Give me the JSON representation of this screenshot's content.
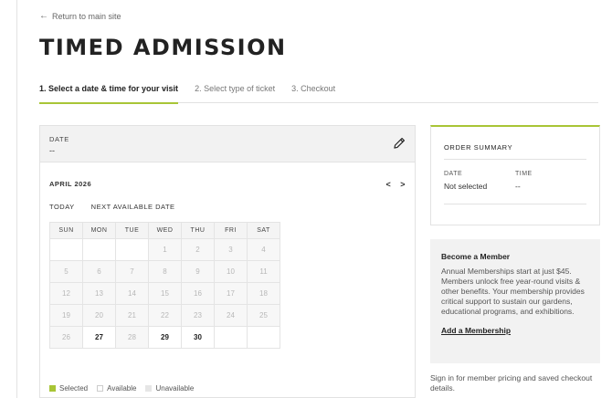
{
  "nav": {
    "return_arrow": "←",
    "return_label": "Return to main site"
  },
  "page_title": "TIMED ADMISSION",
  "steps": [
    {
      "label": "1. Select a date & time for your visit",
      "active": true
    },
    {
      "label": "2. Select type of ticket",
      "active": false
    },
    {
      "label": "3. Checkout",
      "active": false
    }
  ],
  "date_panel": {
    "label": "DATE",
    "value": "--",
    "edit_icon": "pencil-icon"
  },
  "calendar": {
    "month": "APRIL 2026",
    "prev": "<",
    "next": ">",
    "today": "TODAY",
    "next_available": "NEXT AVAILABLE DATE",
    "weekdays": [
      "SUN",
      "MON",
      "TUE",
      "WED",
      "THU",
      "FRI",
      "SAT"
    ],
    "weeks": [
      [
        "",
        "",
        "",
        "1",
        "2",
        "3",
        "4"
      ],
      [
        "5",
        "6",
        "7",
        "8",
        "9",
        "10",
        "11"
      ],
      [
        "12",
        "13",
        "14",
        "15",
        "16",
        "17",
        "18"
      ],
      [
        "19",
        "20",
        "21",
        "22",
        "23",
        "24",
        "25"
      ],
      [
        "26",
        "27",
        "28",
        "29",
        "30",
        "",
        ""
      ]
    ],
    "available_days": [
      "27",
      "29",
      "30"
    ],
    "selected_day": ""
  },
  "legend": {
    "selected": "Selected",
    "available": "Available",
    "unavailable": "Unavailable"
  },
  "colors": {
    "accent": "#a8c536",
    "unavailable_bg": "#f7f7f7",
    "unavailable_text": "#b8b8b8"
  },
  "order_summary": {
    "title": "ORDER SUMMARY",
    "date_label": "DATE",
    "date_value": "Not selected",
    "time_label": "TIME",
    "time_value": "--"
  },
  "membership": {
    "title": "Become a Member",
    "text": "Annual Memberships start at just $45. Members unlock free year-round visits & other benefits. Your membership provides critical support to sustain our gardens, educational programs, and exhibitions.",
    "link": "Add a Membership"
  },
  "sign_in_text": "Sign in for member pricing and saved checkout details."
}
